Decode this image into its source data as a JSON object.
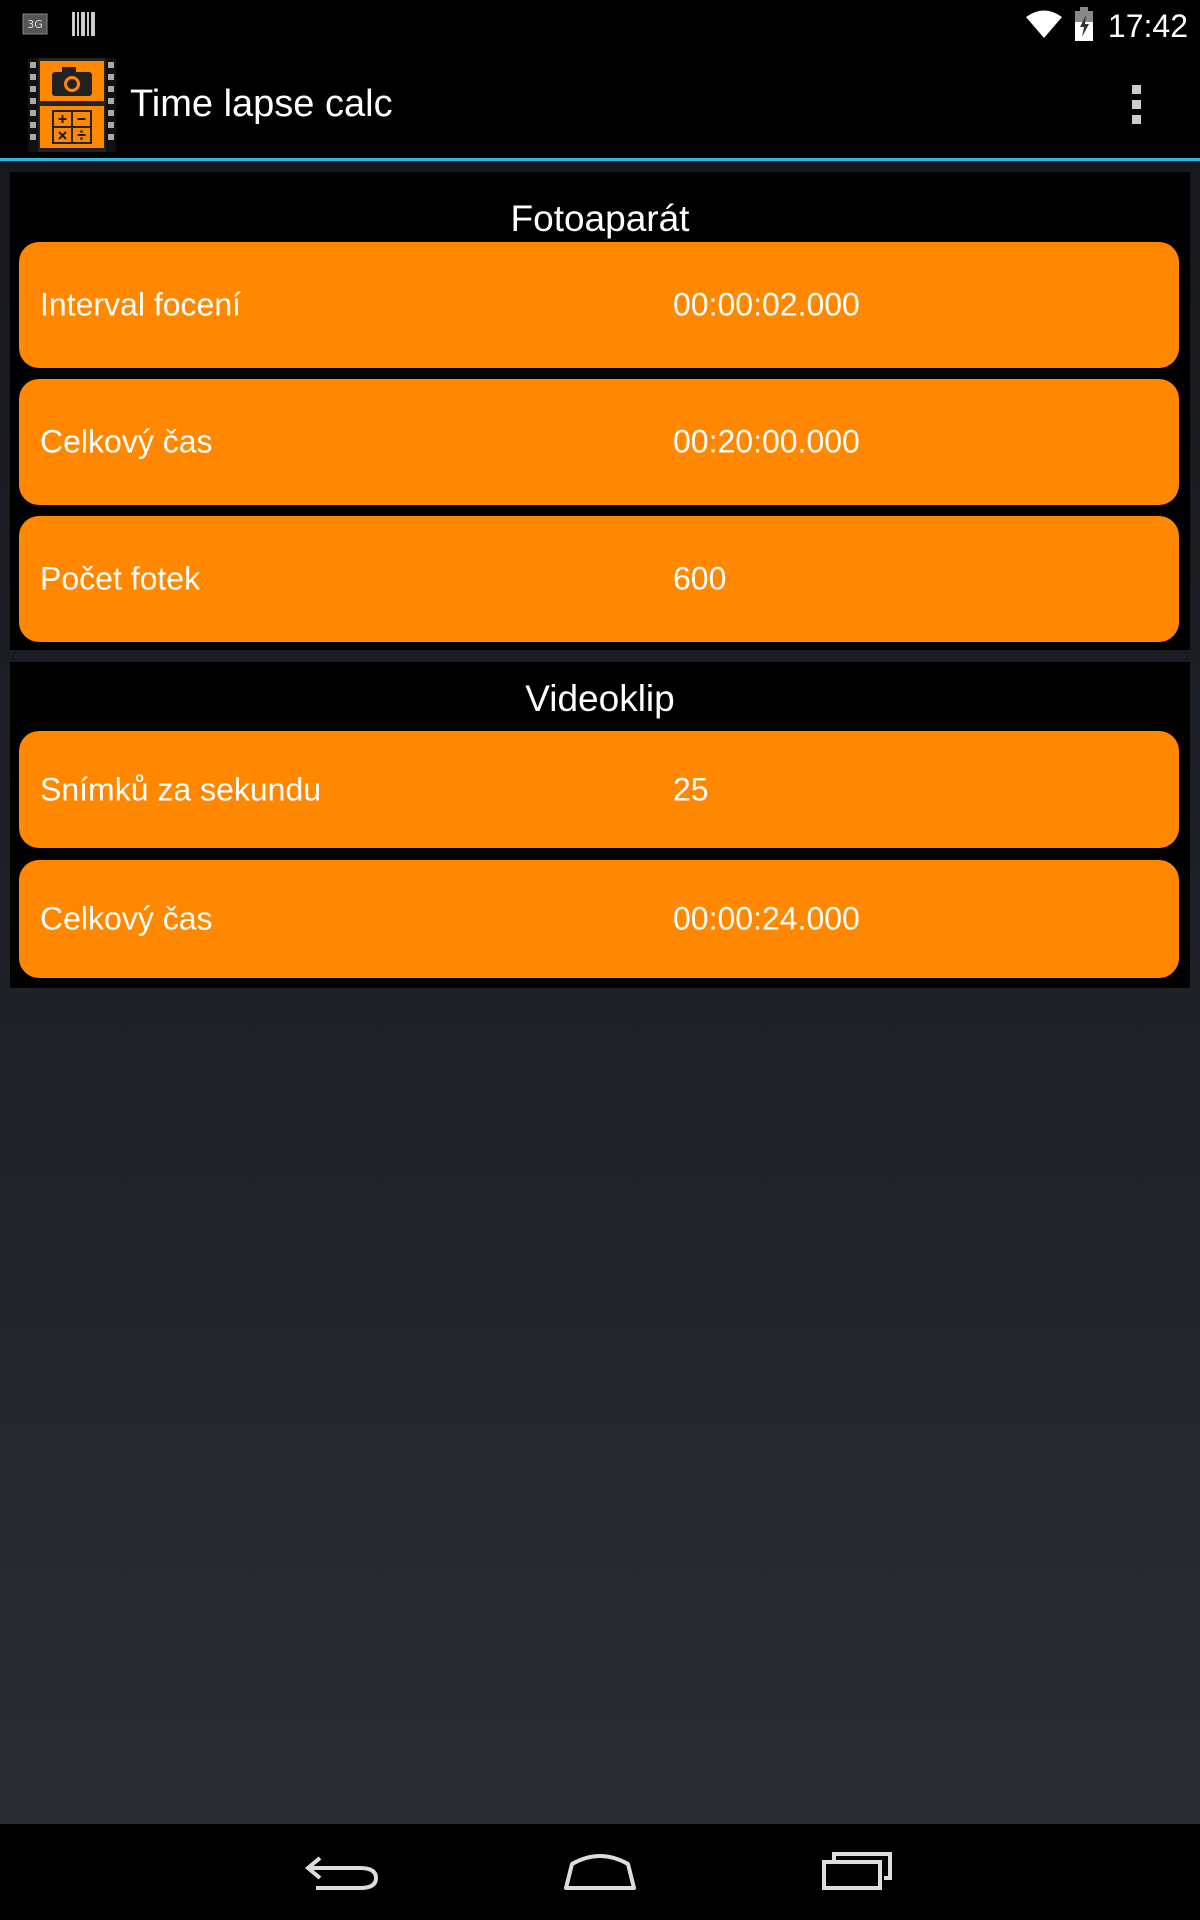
{
  "status_bar": {
    "network_label": "3G",
    "time": "17:42"
  },
  "action_bar": {
    "app_title": "Time lapse calc",
    "app_icon": "camera-calculator-icon",
    "overflow_icon": "overflow-menu-icon"
  },
  "camera_section": {
    "title": "Fotoaparát",
    "rows": [
      {
        "label": "Interval focení",
        "value": "00:00:02.000"
      },
      {
        "label": "Celkový čas",
        "value": "00:20:00.000"
      },
      {
        "label": "Počet fotek",
        "value": "600"
      }
    ]
  },
  "video_section": {
    "title": "Videoklip",
    "rows": [
      {
        "label": "Snímků za sekundu",
        "value": "25"
      },
      {
        "label": "Celkový čas",
        "value": "00:00:24.000"
      }
    ]
  },
  "nav_bar": {
    "back_icon": "back-icon",
    "home_icon": "home-icon",
    "recents_icon": "recents-icon"
  },
  "colors": {
    "accent": "#33b5e5",
    "row_background": "#ff8800"
  }
}
